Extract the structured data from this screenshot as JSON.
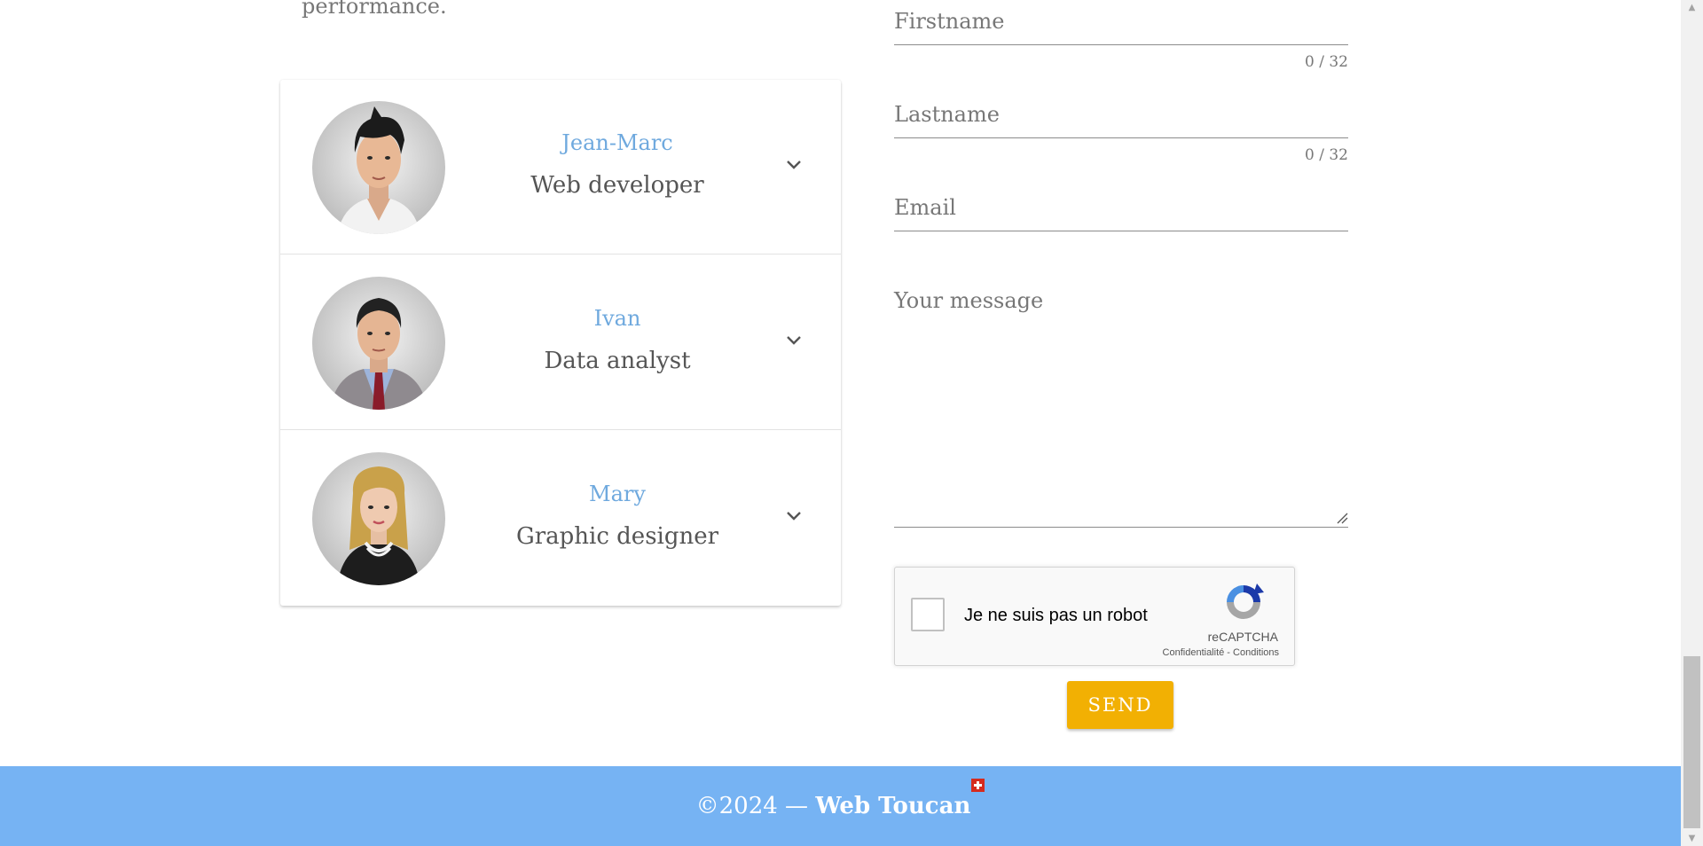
{
  "intro": {
    "text_tail": "performance."
  },
  "team": {
    "members": [
      {
        "name": "Jean-Marc",
        "role": "Web developer",
        "avatar": "avatar-young-man"
      },
      {
        "name": "Ivan",
        "role": "Data analyst",
        "avatar": "avatar-man-suit"
      },
      {
        "name": "Mary",
        "role": "Graphic designer",
        "avatar": "avatar-blonde-woman"
      }
    ],
    "expand_icon": "chevron-down-icon"
  },
  "contact_form": {
    "firstname": {
      "label": "Firstname",
      "value": "",
      "counter": "0 / 32"
    },
    "lastname": {
      "label": "Lastname",
      "value": "",
      "counter": "0 / 32"
    },
    "email": {
      "label": "Email",
      "value": ""
    },
    "message": {
      "label": "Your message",
      "value": ""
    },
    "recaptcha": {
      "label": "Je ne suis pas un robot",
      "brand": "reCAPTCHA",
      "links": "Confidentialité - Conditions",
      "checked": false
    },
    "send_label": "SEND"
  },
  "footer": {
    "copyright": "©2024 —",
    "brand": "Web Toucan",
    "flag_icon": "swiss-flag-icon"
  },
  "colors": {
    "accent_name": "#6fa9de",
    "button": "#f2b003",
    "footer_bg": "#76b3f3"
  }
}
